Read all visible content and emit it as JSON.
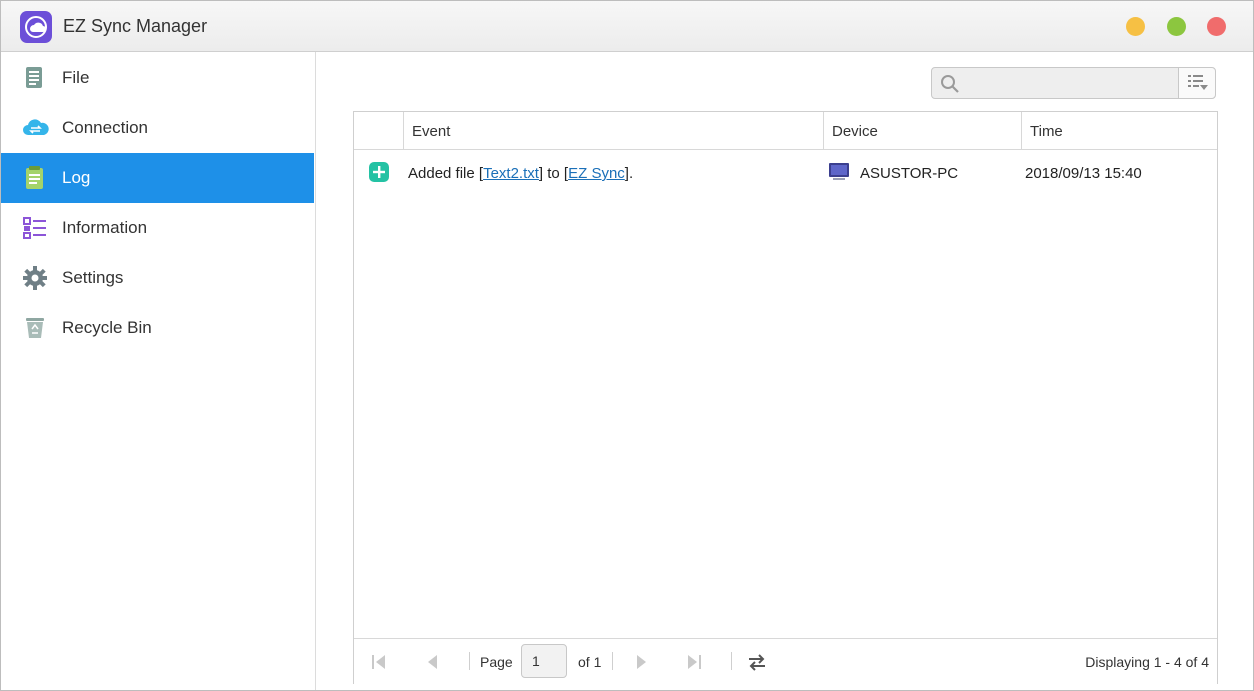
{
  "window": {
    "title": "EZ Sync Manager"
  },
  "sidebar": {
    "items": [
      {
        "label": "File",
        "icon": "file-icon"
      },
      {
        "label": "Connection",
        "icon": "cloud-connection-icon"
      },
      {
        "label": "Log",
        "icon": "log-icon",
        "active": true
      },
      {
        "label": "Information",
        "icon": "information-list-icon"
      },
      {
        "label": "Settings",
        "icon": "gear-icon"
      },
      {
        "label": "Recycle Bin",
        "icon": "recycle-bin-icon"
      }
    ]
  },
  "search": {
    "value": "",
    "placeholder": ""
  },
  "table": {
    "columns": [
      "",
      "Event",
      "Device",
      "Time"
    ],
    "rows": [
      {
        "icon": "add-file-icon",
        "event_prefix": "Added file [",
        "event_link1": "Text2.txt",
        "event_mid": "] to [",
        "event_link2": "EZ Sync",
        "event_suffix": "].",
        "device": "ASUSTOR-PC",
        "time": "2018/09/13 15:40"
      }
    ]
  },
  "pager": {
    "page_label": "Page",
    "page_value": "1",
    "of_label": "of 1",
    "displaying": "Displaying 1 - 4 of 4"
  },
  "colors": {
    "accent": "#1e90e8",
    "add_icon": "#24c2a4",
    "link": "#1a6fb8",
    "window_min": "#f6c044",
    "window_max": "#8cc63f",
    "window_close": "#f06c6c"
  }
}
